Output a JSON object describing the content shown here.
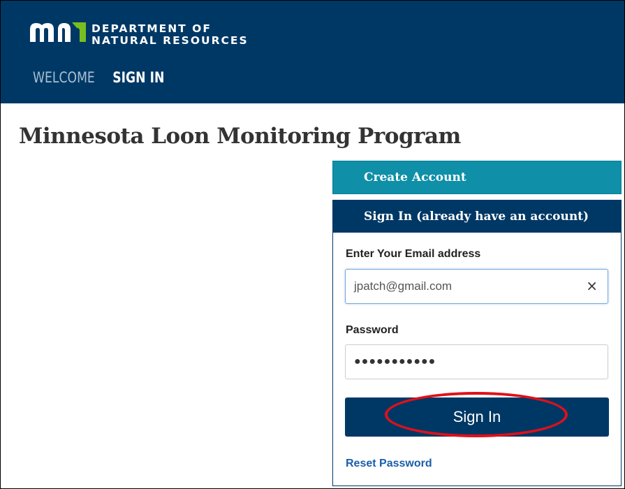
{
  "header": {
    "dept_line1": "DEPARTMENT OF",
    "dept_line2": "NATURAL RESOURCES",
    "logo_icon": "mn-logo-icon",
    "nav": {
      "welcome": "WELCOME",
      "sign_in": "SIGN IN"
    },
    "bg_color": "#003865"
  },
  "page_title": "Minnesota Loon Monitoring Program",
  "create_account": {
    "label": "Create Account",
    "color": "#0f8fa8"
  },
  "signin_panel": {
    "heading": "Sign In (already have an account)",
    "email_label": "Enter Your Email address",
    "email_value": "jpatch@gmail.com",
    "clear_icon": "×",
    "password_label": "Password",
    "password_value": "●●●●●●●●●●●",
    "button_label": "Sign In",
    "reset_link": "Reset Password",
    "annotation": "red-oval-highlight"
  }
}
